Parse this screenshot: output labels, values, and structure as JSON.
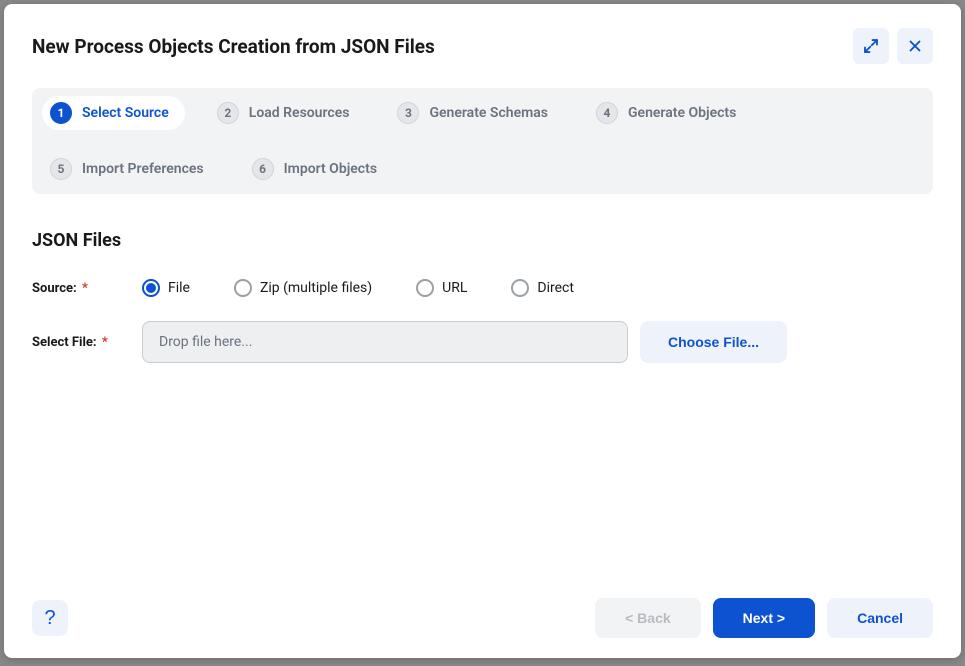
{
  "dialog": {
    "title": "New Process Objects Creation from JSON Files"
  },
  "stepper": {
    "steps": [
      {
        "num": "1",
        "label": "Select Source",
        "active": true
      },
      {
        "num": "2",
        "label": "Load Resources",
        "active": false
      },
      {
        "num": "3",
        "label": "Generate Schemas",
        "active": false
      },
      {
        "num": "4",
        "label": "Generate Objects",
        "active": false
      },
      {
        "num": "5",
        "label": "Import Preferences",
        "active": false
      },
      {
        "num": "6",
        "label": "Import Objects",
        "active": false
      }
    ]
  },
  "section": {
    "title": "JSON Files",
    "sourceLabel": "Source:",
    "selectFileLabel": "Select File:",
    "requiredMark": "*"
  },
  "sourceOptions": [
    {
      "label": "File",
      "checked": true
    },
    {
      "label": "Zip (multiple files)",
      "checked": false
    },
    {
      "label": "URL",
      "checked": false
    },
    {
      "label": "Direct",
      "checked": false
    }
  ],
  "dropzone": {
    "placeholder": "Drop file here..."
  },
  "buttons": {
    "chooseFile": "Choose File...",
    "help": "?",
    "back": "< Back",
    "next": "Next >",
    "cancel": "Cancel"
  }
}
